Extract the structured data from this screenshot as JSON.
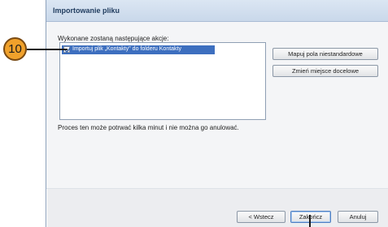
{
  "window": {
    "title": "Importowanie pliku"
  },
  "content": {
    "actions_label": "Wykonane zostaną następujące akcje:",
    "actions": [
      {
        "label": "Importuj plik „Kontakty\" do folderu Kontakty",
        "checked": true
      }
    ],
    "info_text": "Proces ten może potrwać kilka minut i nie można go anulować."
  },
  "side_buttons": {
    "map_fields": "Mapuj pola niestandardowe",
    "change_destination": "Zmień miejsce docelowe"
  },
  "footer_buttons": {
    "back": "< Wstecz",
    "finish": "Zakończ",
    "cancel": "Anuluj"
  },
  "annotation": {
    "step_number": "10"
  },
  "colors": {
    "callout": "#f0a12b",
    "selection": "#3d6fbf",
    "titlebar": "#c9d8ea"
  }
}
